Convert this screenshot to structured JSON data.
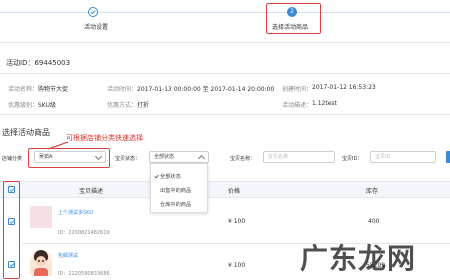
{
  "steps": [
    {
      "label": "活动设置",
      "number": "",
      "state": "done"
    },
    {
      "label": "选择活动商品",
      "number": "2",
      "state": "active"
    }
  ],
  "activity_id_label": "活动ID：69445003",
  "info": {
    "name_label": "活动名称：",
    "name_value": "购物节大促",
    "time_label": "活动时间：",
    "time_value": "2017-01-13 00:00:00 至 2017-01-14 20:00:00",
    "created_label": "创建时间：",
    "created_value": "2017-01-12 16:53:23",
    "type_label": "优惠级别：",
    "type_value": "SKU级",
    "method_label": "优惠方式：",
    "method_value": "打折",
    "desc_label": "活动描述：",
    "desc_value": "1.12test"
  },
  "section_title": "选择活动商品",
  "annotation": "可根据店铺分类快速选择",
  "filters": {
    "category_label": "店铺分类",
    "category_value": "吴茹A",
    "status_label": "宝贝状态：",
    "status_value": "全部状态",
    "name_label": "宝贝名称：",
    "name_placeholder": "宝贝名称",
    "id_label": "宝贝ID：",
    "id_placeholder": "宝贝ID"
  },
  "status_options": [
    "全部状态",
    "出售中的商品",
    "仓库中的商品"
  ],
  "table": {
    "headers": [
      "宝贝描述",
      "价格",
      "库存"
    ],
    "rows": [
      {
        "title": "上个测试多SKU",
        "id": "ID：2200821482619",
        "price": "¥ 100",
        "stock": "400"
      },
      {
        "title": "包邮测试",
        "id": "ID：2120590833686",
        "price": "¥ 100",
        "stock": "58299"
      }
    ]
  },
  "watermark": "广东龙网",
  "colors": {
    "accent": "#3b8ad9",
    "highlight": "#e04040",
    "annotation": "#e0312b"
  }
}
